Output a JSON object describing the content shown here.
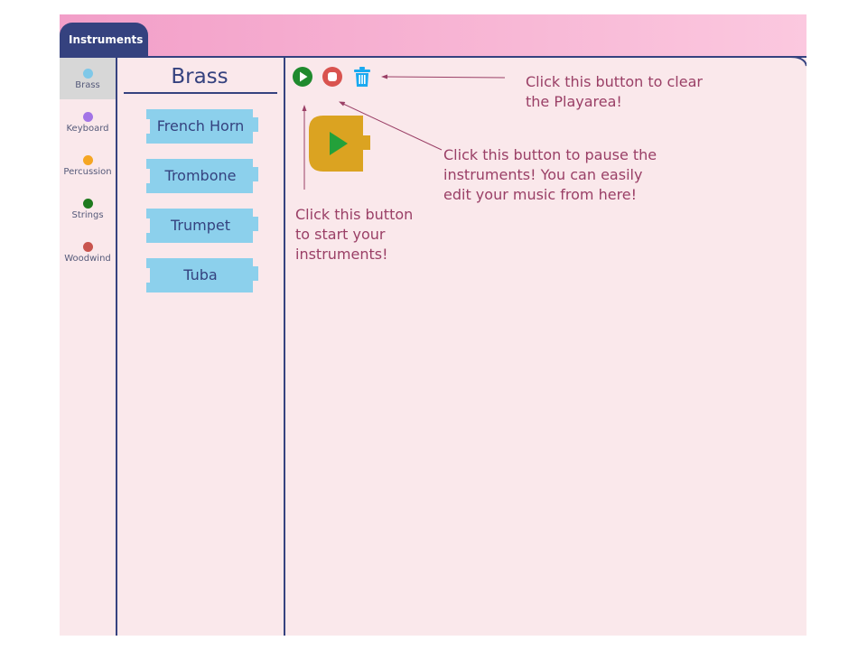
{
  "header": {
    "tab_label": "Instruments"
  },
  "categories": [
    {
      "label": "Brass",
      "color": "#7fc8e8",
      "selected": true
    },
    {
      "label": "Keyboard",
      "color": "#a374e6",
      "selected": false
    },
    {
      "label": "Percussion",
      "color": "#f5a623",
      "selected": false
    },
    {
      "label": "Strings",
      "color": "#1e7a1e",
      "selected": false
    },
    {
      "label": "Woodwind",
      "color": "#c9544e",
      "selected": false
    }
  ],
  "flyout": {
    "title": "Brass",
    "blocks": [
      "French Horn",
      "Trombone",
      "Trumpet",
      "Tuba"
    ],
    "block_color": "#8cd0ec"
  },
  "toolbar": {
    "play_icon": "play-circle-icon",
    "stop_icon": "stop-circle-icon",
    "trash_icon": "trash-icon",
    "play_color": "#1f8a2e",
    "stop_color": "#d9534f",
    "trash_color": "#19a9f0"
  },
  "workspace": {
    "start_block_color": "#dba321",
    "start_block_icon": "play-icon"
  },
  "annotations": {
    "clear": [
      "Click this button to clear",
      "the Playarea!"
    ],
    "pause": [
      "Click this button to pause the",
      "instruments! You can easily",
      "edit your music from here!"
    ],
    "start": [
      "Click this button",
      "to start your",
      "instruments!"
    ]
  }
}
